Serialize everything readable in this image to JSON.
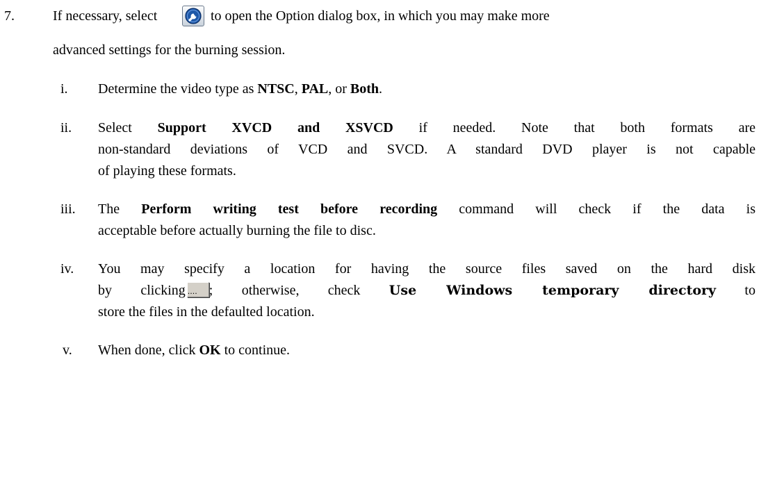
{
  "step": {
    "number": "7.",
    "text_before_icon": "If necessary, select",
    "icon": "wrench-option-icon",
    "text_after_icon": "to open the Option dialog box, in which you may make more",
    "line2": "advanced settings for the burning session."
  },
  "items": [
    {
      "numeral": "i.",
      "t1": "Determine the video type as ",
      "b1": "NTSC",
      "t2": ", ",
      "b2": "PAL",
      "t3": ", or ",
      "b3": "Both",
      "t4": "."
    },
    {
      "numeral": "ii.",
      "t1": "Select ",
      "b1": "Support XVCD and XSVCD",
      "t2": " if needed. Note that both formats are",
      "line2": "non-standard deviations of VCD and SVCD. A standard DVD player is not capable",
      "line3": "of playing these formats."
    },
    {
      "numeral": "iii.",
      "t1": "The ",
      "b1": "Perform writing test before recording",
      "t2": " command will check if the data is",
      "line2": "acceptable before actually burning the file to disc."
    },
    {
      "numeral": "iv.",
      "line1": "You may specify a location for having the source files saved on the hard disk",
      "t1": "by clicking",
      "t2": "; otherwise, check ",
      "b1": "Use Windows temporary directory",
      "t3": " to",
      "line3": "store the files in the defaulted location.",
      "browse_glyph": "....",
      "browse_icon": "browse-ellipsis-button"
    },
    {
      "numeral": "v.",
      "t1": "When done, click ",
      "b1": "OK",
      "t2": " to continue."
    }
  ]
}
